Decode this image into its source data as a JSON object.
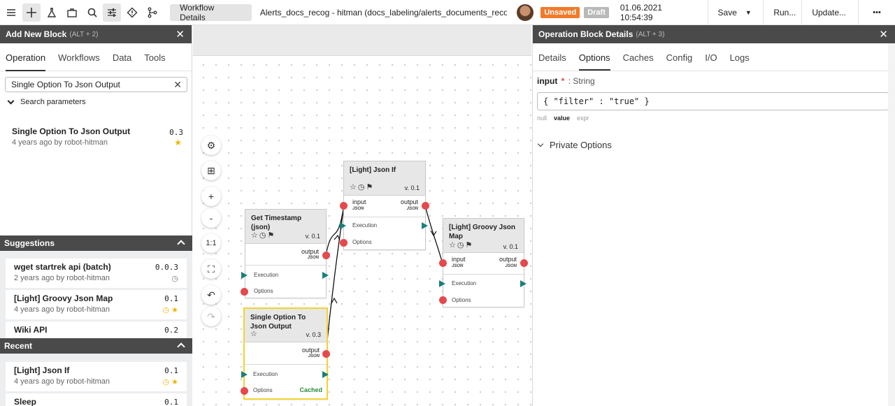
{
  "toolbar": {
    "icons": [
      "menu-icon",
      "crosshair-icon",
      "flask-icon",
      "briefcase-icon",
      "search-icon",
      "sliders-icon",
      "warning-icon",
      "branch-icon"
    ],
    "tab_label": "Workflow Details",
    "workflow_title": "Alerts_docs_recog - hitman (docs_labeling/alerts_documents_recognitio",
    "badge_unsaved": "Unsaved",
    "badge_draft": "Draft",
    "timestamp": "01.06.2021 10:54:39",
    "save_label": "Save",
    "run_label": "Run...",
    "update_label": "Update...",
    "more_label": "•••"
  },
  "left_panel": {
    "title": "Add New Block",
    "hint": "(ALT + 2)",
    "tabs": [
      "Operation",
      "Workflows",
      "Data",
      "Tools"
    ],
    "active_tab": "Operation",
    "search_value": "Single Option To Json Output",
    "search_params_label": "Search parameters",
    "result": {
      "title": "Single Option To Json Output",
      "meta": "4 years ago by robot-hitman",
      "version": "0.3",
      "starred": true
    },
    "suggestions_title": "Suggestions",
    "suggestions": [
      {
        "title": "wget startrek api (batch)",
        "meta": "2 years ago by robot-hitman",
        "version": "0.0.3",
        "icons": "◷"
      },
      {
        "title": "[Light] Groovy Json Map",
        "meta": "4 years ago by robot-hitman",
        "version": "0.1",
        "icons": "◷ ★"
      },
      {
        "title": "Wiki API",
        "meta": "",
        "version": "0.2",
        "icons": ""
      }
    ],
    "recent_title": "Recent",
    "recent": [
      {
        "title": "[Light] Json If",
        "meta": "4 years ago by robot-hitman",
        "version": "0.1",
        "icons": "◷ ★"
      },
      {
        "title": "Sleep",
        "meta": "",
        "version": "0.1",
        "icons": ""
      }
    ]
  },
  "canvas": {
    "controls": [
      "⚙",
      "⊞",
      "+",
      "-",
      "1:1",
      "⛶",
      "↶",
      "↷"
    ],
    "nodes": {
      "timestamp": {
        "title": "Get Timestamp (json)",
        "version": "v. 0.1",
        "output": "output",
        "output_type": "JSON",
        "execution": "Execution",
        "options": "Options"
      },
      "single": {
        "title": "Single Option To Json Output",
        "version": "v. 0.3",
        "output": "output",
        "output_type": "JSON",
        "execution": "Execution",
        "options": "Options",
        "cached": "Cached"
      },
      "jsonif": {
        "title": "[Light] Json If",
        "version": "v. 0.1",
        "input": "input",
        "input_type": "JSON",
        "output": "output",
        "output_type": "JSON",
        "execution": "Execution",
        "options": "Options"
      },
      "groovy": {
        "title": "[Light] Groovy Json Map",
        "version": "v. 0.1",
        "input": "input",
        "input_type": "JSON",
        "output": "output",
        "output_type": "JSON",
        "execution": "Execution",
        "options": "Options"
      }
    },
    "node_icons": "☆◷⚑"
  },
  "right_panel": {
    "title": "Operation Block Details",
    "hint": "(ALT + 3)",
    "tabs": [
      "Details",
      "Options",
      "Caches",
      "Config",
      "I/O",
      "Logs"
    ],
    "active_tab": "Options",
    "input_name": "input",
    "input_required_mark": "*",
    "input_type": ": String",
    "input_value": "{ \"filter\" : \"true\" }",
    "modes": [
      "null",
      "value",
      "expr"
    ],
    "active_mode": "value",
    "private_options_label": "Private Options"
  },
  "colors": {
    "accent_dark": "#4a4a4a",
    "port_red": "#e5484d",
    "exec_teal": "#1a7f7a",
    "unsaved_orange": "#f07a2a",
    "selected_yellow": "#f3d232",
    "star_gold": "#f1b400"
  }
}
